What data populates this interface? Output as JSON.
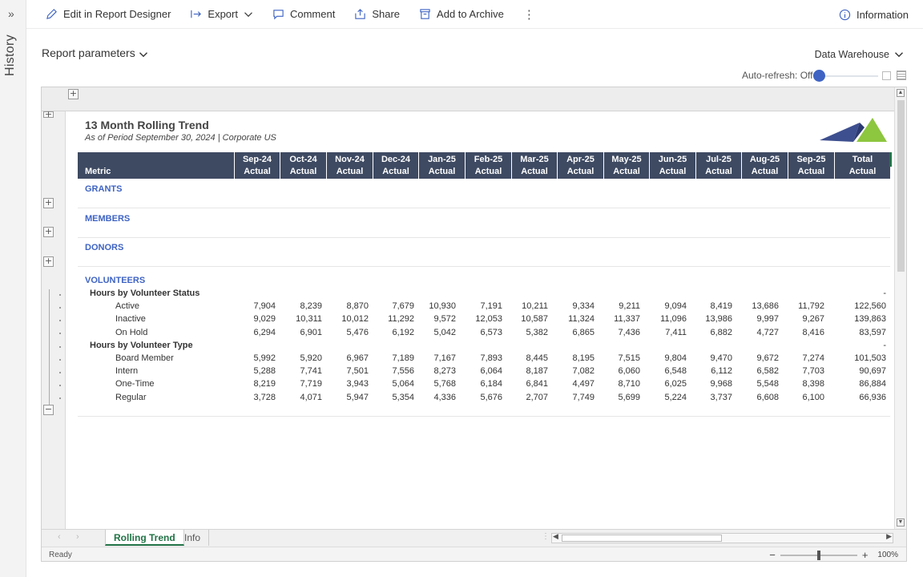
{
  "rail": {
    "expand_glyph": "»",
    "label": "History"
  },
  "toolbar": {
    "edit": "Edit in Report Designer",
    "export": "Export",
    "comment": "Comment",
    "share": "Share",
    "archive": "Add to Archive",
    "more": "⋮",
    "info": "Information"
  },
  "params": {
    "label": "Report parameters"
  },
  "source": {
    "label": "Data Warehouse"
  },
  "autorefresh": {
    "label": "Auto-refresh: Off"
  },
  "report": {
    "title": "13 Month Rolling Trend",
    "subtitle": "As of Period September 30, 2024 | Corporate US",
    "metric_header": "Metric",
    "columns": [
      {
        "month": "Sep-24",
        "kind": "Actual"
      },
      {
        "month": "Oct-24",
        "kind": "Actual"
      },
      {
        "month": "Nov-24",
        "kind": "Actual"
      },
      {
        "month": "Dec-24",
        "kind": "Actual"
      },
      {
        "month": "Jan-25",
        "kind": "Actual"
      },
      {
        "month": "Feb-25",
        "kind": "Actual"
      },
      {
        "month": "Mar-25",
        "kind": "Actual"
      },
      {
        "month": "Apr-25",
        "kind": "Actual"
      },
      {
        "month": "May-25",
        "kind": "Actual"
      },
      {
        "month": "Jun-25",
        "kind": "Actual"
      },
      {
        "month": "Jul-25",
        "kind": "Actual"
      },
      {
        "month": "Aug-25",
        "kind": "Actual"
      },
      {
        "month": "Sep-25",
        "kind": "Actual"
      },
      {
        "month": "Total",
        "kind": "Actual"
      }
    ],
    "sections": [
      "GRANTS",
      "MEMBERS",
      "DONORS",
      "VOLUNTEERS"
    ],
    "rows": [
      {
        "label": "Hours by Volunteer Status",
        "group": true,
        "values": [
          "",
          "",
          "",
          "",
          "",
          "",
          "",
          "",
          "",
          "",
          "",
          "",
          "",
          "-"
        ]
      },
      {
        "label": "Active",
        "group": false,
        "values": [
          "7,904",
          "8,239",
          "8,870",
          "7,679",
          "10,930",
          "7,191",
          "10,211",
          "9,334",
          "9,211",
          "9,094",
          "8,419",
          "13,686",
          "11,792",
          "122,560"
        ]
      },
      {
        "label": "Inactive",
        "group": false,
        "values": [
          "9,029",
          "10,311",
          "10,012",
          "11,292",
          "9,572",
          "12,053",
          "10,587",
          "11,324",
          "11,337",
          "11,096",
          "13,986",
          "9,997",
          "9,267",
          "139,863"
        ]
      },
      {
        "label": "On Hold",
        "group": false,
        "values": [
          "6,294",
          "6,901",
          "5,476",
          "6,192",
          "5,042",
          "6,573",
          "5,382",
          "6,865",
          "7,436",
          "7,411",
          "6,882",
          "4,727",
          "8,416",
          "83,597"
        ]
      },
      {
        "label": "Hours by Volunteer Type",
        "group": true,
        "values": [
          "",
          "",
          "",
          "",
          "",
          "",
          "",
          "",
          "",
          "",
          "",
          "",
          "",
          "-"
        ]
      },
      {
        "label": "Board Member",
        "group": false,
        "values": [
          "5,992",
          "5,920",
          "6,967",
          "7,189",
          "7,167",
          "7,893",
          "8,445",
          "8,195",
          "7,515",
          "9,804",
          "9,470",
          "9,672",
          "7,274",
          "101,503"
        ]
      },
      {
        "label": "Intern",
        "group": false,
        "values": [
          "5,288",
          "7,741",
          "7,501",
          "7,556",
          "8,273",
          "6,064",
          "8,187",
          "7,082",
          "6,060",
          "6,548",
          "6,112",
          "6,582",
          "7,703",
          "90,697"
        ]
      },
      {
        "label": "One-Time",
        "group": false,
        "values": [
          "8,219",
          "7,719",
          "3,943",
          "5,064",
          "5,768",
          "6,184",
          "6,841",
          "4,497",
          "8,710",
          "6,025",
          "9,968",
          "5,548",
          "8,398",
          "86,884"
        ]
      },
      {
        "label": "Regular",
        "group": false,
        "values": [
          "3,728",
          "4,071",
          "5,947",
          "5,354",
          "4,336",
          "5,676",
          "2,707",
          "7,749",
          "5,699",
          "5,224",
          "3,737",
          "6,608",
          "6,100",
          "66,936"
        ]
      }
    ]
  },
  "sheets": {
    "tabs": [
      "Rolling Trend",
      "Info"
    ],
    "active": "Rolling Trend"
  },
  "status": {
    "text": "Ready",
    "zoom": "100%"
  },
  "colors": {
    "header_band": "#3e4a62",
    "section": "#3e63c3",
    "active_tab": "#217346",
    "slider_knob": "#3e63c3"
  }
}
